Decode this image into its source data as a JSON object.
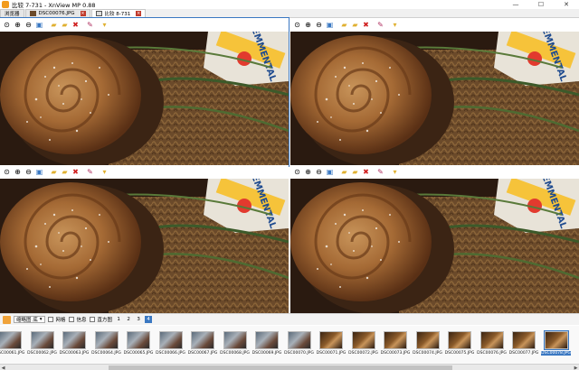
{
  "window": {
    "title": "比较 7-731 - XnView MP 0.88",
    "controls": [
      "—",
      "☐",
      "✕"
    ]
  },
  "tabs": [
    {
      "label": "浏览器"
    },
    {
      "label": "DSC00076.JPG"
    },
    {
      "label": "比较 8-731"
    }
  ],
  "toolbar_icons": [
    "zoom-fit-icon",
    "zoom-in-icon",
    "zoom-out-icon",
    "fullscreen-icon",
    "open-folder-icon",
    "save-icon",
    "delete-icon",
    "tag-icon",
    "more-icon"
  ],
  "bottombar": {
    "thumb_select": "缩略图 底",
    "checkboxes": [
      "网格",
      "信息",
      "直方图"
    ],
    "pages": [
      "1",
      "2",
      "3",
      "4"
    ],
    "active_page": "4"
  },
  "filmstrip": [
    {
      "label": "DSC00061.JPG"
    },
    {
      "label": "DSC00062.JPG"
    },
    {
      "label": "DSC00063.JPG"
    },
    {
      "label": "DSC00064.JPG"
    },
    {
      "label": "DSC00065.JPG"
    },
    {
      "label": "DSC00066.JPG"
    },
    {
      "label": "DSC00067.JPG"
    },
    {
      "label": "DSC00068.JPG"
    },
    {
      "label": "DSC00069.JPG"
    },
    {
      "label": "DSC00070.JPG"
    },
    {
      "label": "DSC00071.JPG"
    },
    {
      "label": "DSC00072.JPG"
    },
    {
      "label": "DSC00073.JPG"
    },
    {
      "label": "DSC00074.JPG"
    },
    {
      "label": "DSC00075.JPG"
    },
    {
      "label": "DSC00076.JPG"
    },
    {
      "label": "DSC00077.JPG"
    },
    {
      "label": "DSC00078.JPG"
    }
  ],
  "selected_thumb": "DSC00078.JPG",
  "image_label": "EMMENTAL",
  "colors": {
    "accent": "#3a78c2",
    "pastry": "#9a5a2a",
    "basket": "#6b4a2a",
    "background": "#2a1a10"
  }
}
